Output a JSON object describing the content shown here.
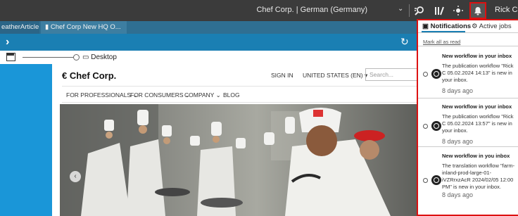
{
  "topbar": {
    "context": "Chef Corp. | German (Germany)",
    "user": "Rick C"
  },
  "tabs": [
    {
      "label": "eatherArticle"
    },
    {
      "label": "Chef Corp New HQ O..."
    }
  ],
  "device": {
    "label": "Desktop"
  },
  "site": {
    "logo": "Chef Corp.",
    "sign_in": "SIGN IN",
    "country": "UNITED STATES (EN)",
    "search_placeholder": "Search...",
    "nav": [
      {
        "label": "FOR PROFESSIONALS"
      },
      {
        "label": "FOR CONSUMERS"
      },
      {
        "label": "COMPANY"
      },
      {
        "label": "BLOG"
      }
    ]
  },
  "notifications": {
    "tab_active": "Notifications",
    "tab_other": "Active jobs",
    "mark_all": "Mark all as read",
    "items": [
      {
        "title": "New workflow in your inbox",
        "body": "The publication workflow \"Rick C 05.02.2024 14:13\" is new in your inbox.",
        "time": "8 days ago"
      },
      {
        "title": "New workflow in your inbox",
        "body": "The publication workflow \"Rick C 05.02.2024 13:57\" is new in your inbox.",
        "time": "8 days ago"
      },
      {
        "title": "New workflow in you inbox",
        "body": "The translation workflow \"farm-inland-prod-large-01-iVZRrxzAcR 2024/02/05 12:00 PM\" is new in your inbox.",
        "time": "8 days ago"
      }
    ]
  }
}
